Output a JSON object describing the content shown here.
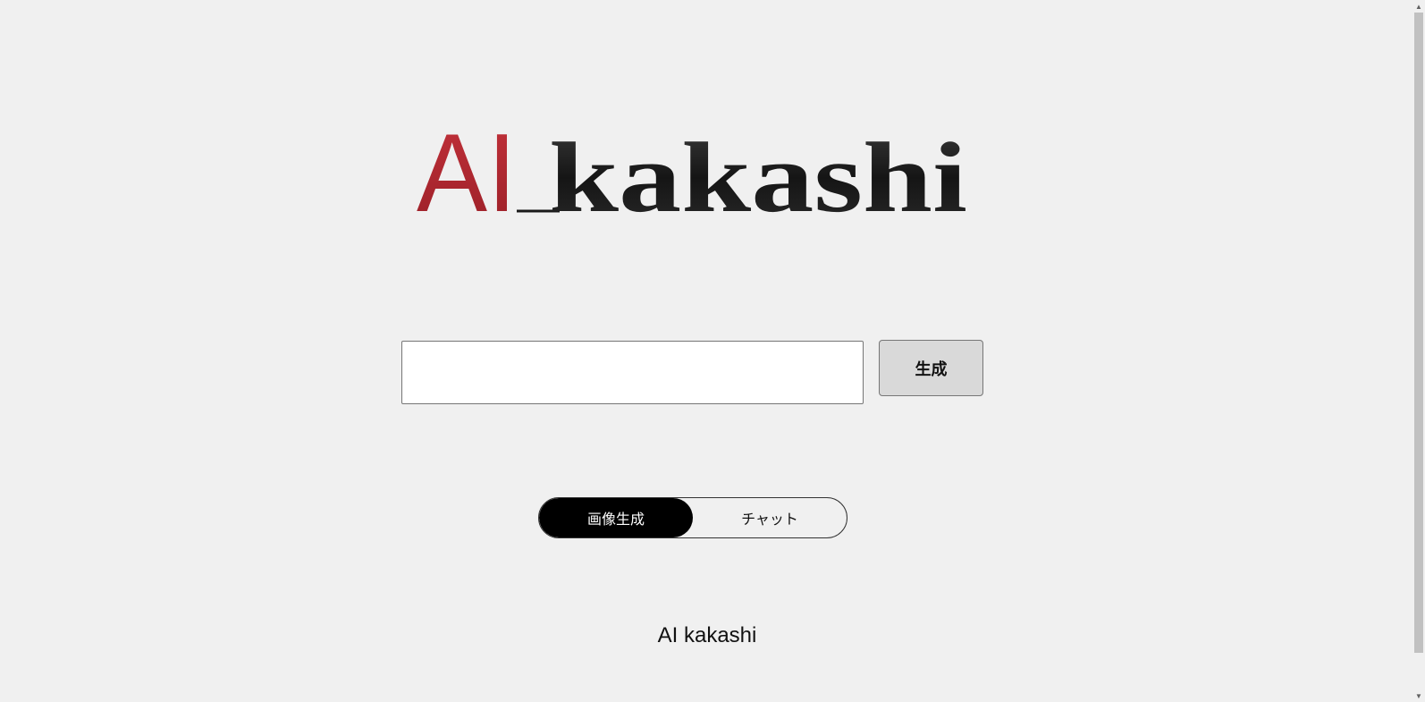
{
  "logo": {
    "prefix": "AI",
    "suffix": "kakashi",
    "prefix_color": "#b0262e",
    "suffix_color": "#1a1a1a"
  },
  "prompt": {
    "value": "",
    "placeholder": ""
  },
  "generate_label": "生成",
  "modes": [
    {
      "label": "画像生成",
      "active": true
    },
    {
      "label": "チャット",
      "active": false
    }
  ],
  "footer": {
    "text": "AI kakashi"
  },
  "scrollbar": {
    "up_icon": "▲",
    "down_icon": "▼"
  },
  "colors": {
    "background": "#f0f0f0",
    "active_toggle": "#000000",
    "button": "#d9d9d9"
  }
}
